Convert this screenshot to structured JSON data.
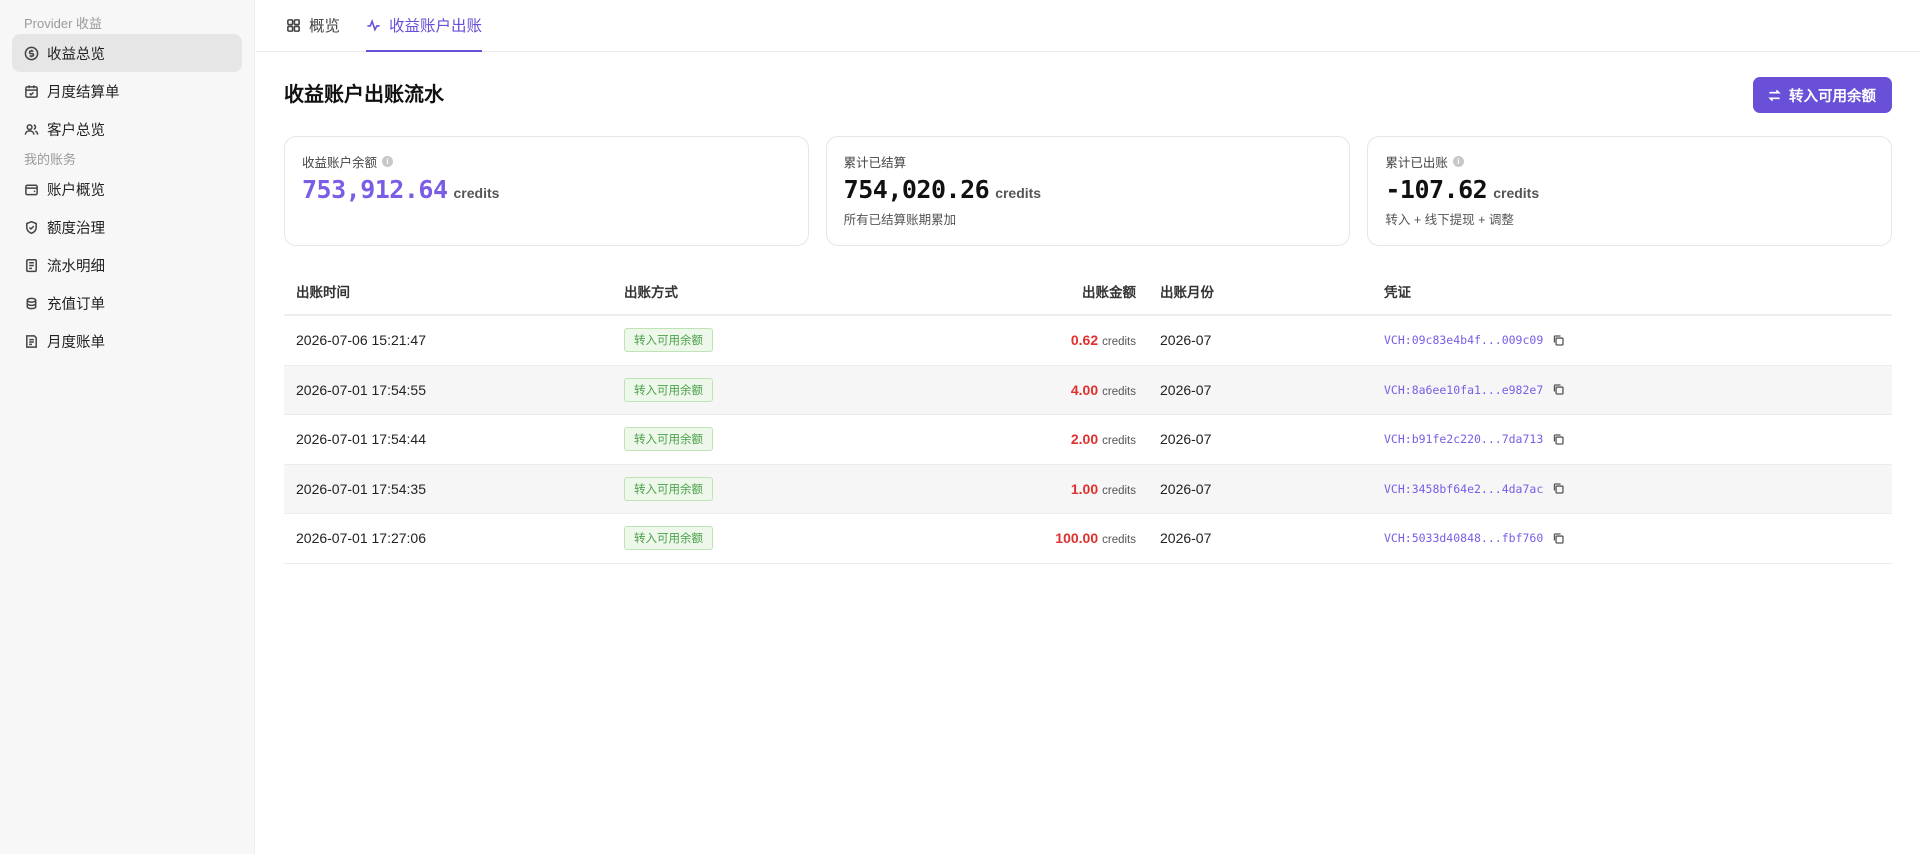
{
  "sidebar": {
    "section1_label": "Provider 收益",
    "section2_label": "我的账务",
    "items": [
      {
        "label": "收益总览",
        "icon": "dollar-circle-icon"
      },
      {
        "label": "月度结算单",
        "icon": "calendar-icon"
      },
      {
        "label": "客户总览",
        "icon": "users-icon"
      },
      {
        "label": "账户概览",
        "icon": "wallet-icon"
      },
      {
        "label": "额度治理",
        "icon": "shield-icon"
      },
      {
        "label": "流水明细",
        "icon": "receipt-icon"
      },
      {
        "label": "充值订单",
        "icon": "coins-icon"
      },
      {
        "label": "月度账单",
        "icon": "bill-icon"
      }
    ]
  },
  "tabs": [
    {
      "label": "概览",
      "icon": "grid-icon"
    },
    {
      "label": "收益账户出账",
      "icon": "activity-icon"
    }
  ],
  "page": {
    "title": "收益账户出账流水",
    "primary_button": "转入可用余额"
  },
  "cards": [
    {
      "label": "收益账户余额",
      "value": "753,912.64",
      "unit": "credits",
      "sub": ""
    },
    {
      "label": "累计已结算",
      "value": "754,020.26",
      "unit": "credits",
      "sub": "所有已结算账期累加"
    },
    {
      "label": "累计已出账",
      "value": "-107.62",
      "unit": "credits",
      "sub": "转入 + 线下提现 + 调整"
    }
  ],
  "table": {
    "headers": [
      "出账时间",
      "出账方式",
      "出账金额",
      "出账月份",
      "凭证"
    ],
    "rows": [
      {
        "time": "2026-07-06 15:21:47",
        "method": "转入可用余额",
        "amount": "0.62",
        "unit": "credits",
        "month": "2026-07",
        "voucher": "VCH:09c83e4b4f...009c09"
      },
      {
        "time": "2026-07-01 17:54:55",
        "method": "转入可用余额",
        "amount": "4.00",
        "unit": "credits",
        "month": "2026-07",
        "voucher": "VCH:8a6ee10fa1...e982e7"
      },
      {
        "time": "2026-07-01 17:54:44",
        "method": "转入可用余额",
        "amount": "2.00",
        "unit": "credits",
        "month": "2026-07",
        "voucher": "VCH:b91fe2c220...7da713"
      },
      {
        "time": "2026-07-01 17:54:35",
        "method": "转入可用余额",
        "amount": "1.00",
        "unit": "credits",
        "month": "2026-07",
        "voucher": "VCH:3458bf64e2...4da7ac"
      },
      {
        "time": "2026-07-01 17:27:06",
        "method": "转入可用余额",
        "amount": "100.00",
        "unit": "credits",
        "month": "2026-07",
        "voucher": "VCH:5033d40848...fbf760"
      }
    ]
  },
  "colors": {
    "accent": "#6a4fd8",
    "balance_value": "#7b5ce6",
    "amount_negative": "#e0302e",
    "tag_green": "#4aa04a"
  }
}
